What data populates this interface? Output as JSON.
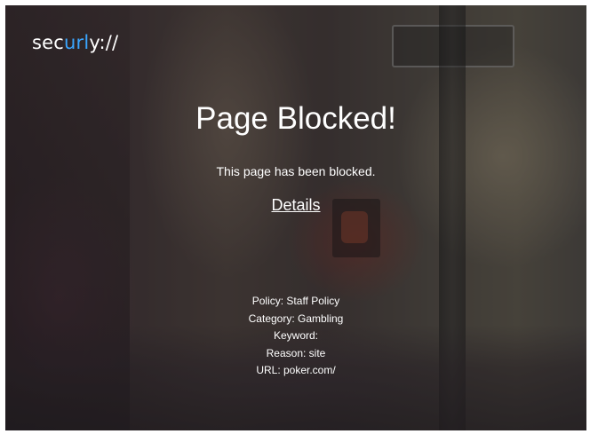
{
  "logo": {
    "part_before": "sec",
    "part_accent": "url",
    "part_after": "y://",
    "accent_color": "#3aa6ff"
  },
  "page": {
    "title": "Page Blocked!",
    "message": "This page has been blocked.",
    "details_link": "Details"
  },
  "block_info": {
    "policy": "Policy: Staff Policy",
    "category": "Category: Gambling",
    "keyword": "Keyword:",
    "reason": "Reason: site",
    "url": "URL: poker.com/"
  },
  "background": {
    "description_icon": "blurred-street-photo",
    "base_color": "#2d2a2e"
  }
}
